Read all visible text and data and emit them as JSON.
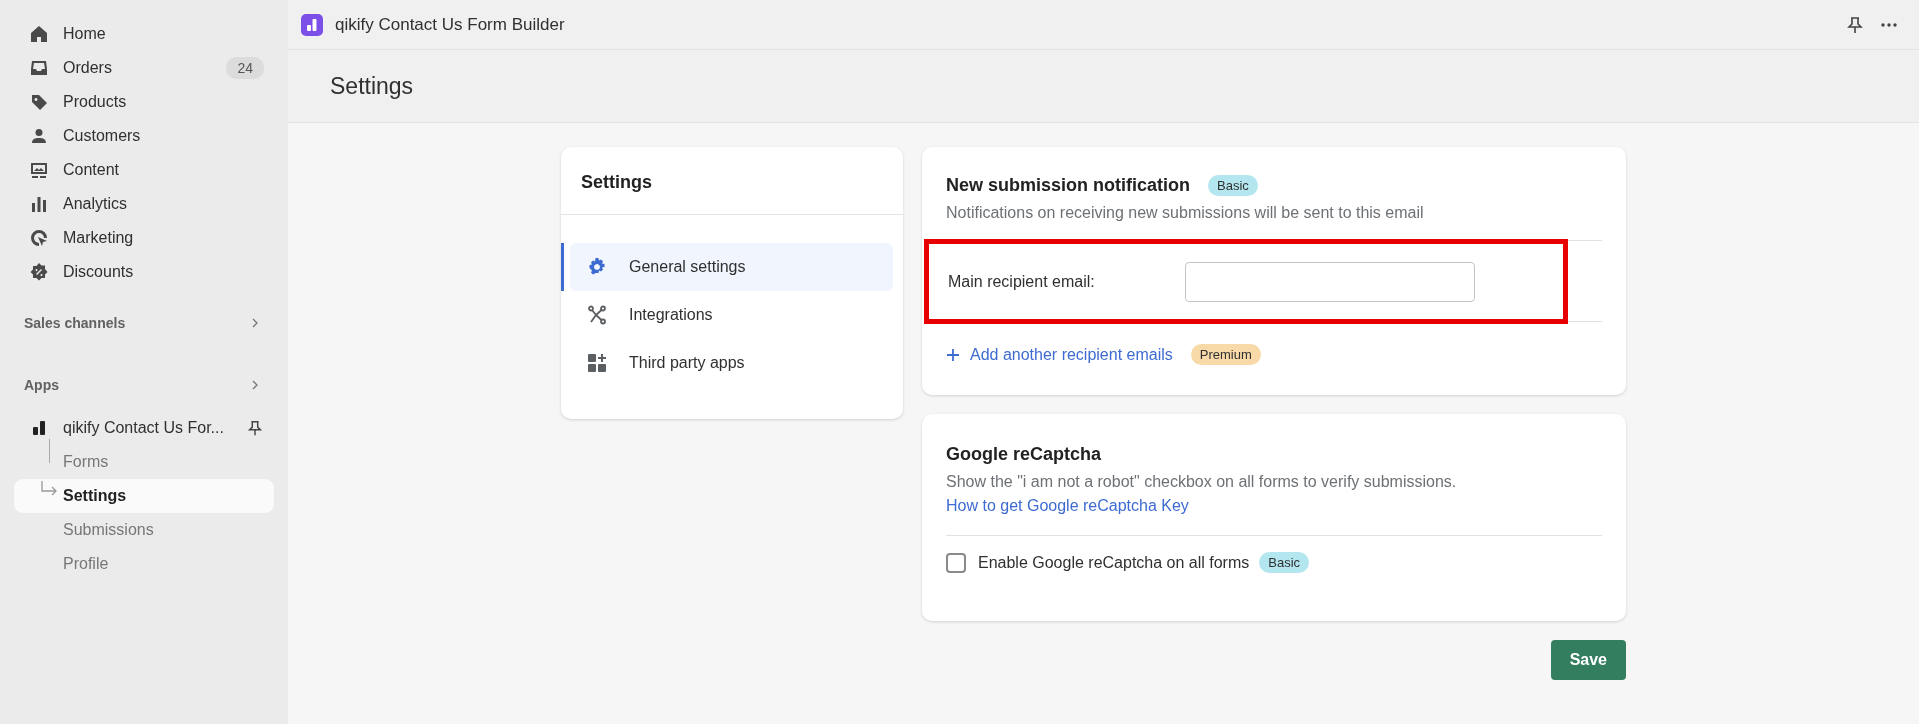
{
  "sidebar": {
    "nav": [
      {
        "label": "Home"
      },
      {
        "label": "Orders",
        "badge": "24"
      },
      {
        "label": "Products"
      },
      {
        "label": "Customers"
      },
      {
        "label": "Content"
      },
      {
        "label": "Analytics"
      },
      {
        "label": "Marketing"
      },
      {
        "label": "Discounts"
      }
    ],
    "sections": [
      {
        "label": "Sales channels"
      },
      {
        "label": "Apps"
      }
    ],
    "app": {
      "label": "qikify Contact Us For...",
      "children": [
        {
          "label": "Forms",
          "selected": false
        },
        {
          "label": "Settings",
          "selected": true
        },
        {
          "label": "Submissions",
          "selected": false
        },
        {
          "label": "Profile",
          "selected": false
        }
      ]
    }
  },
  "top_bar": {
    "title": "qikify Contact Us Form Builder"
  },
  "page": {
    "title": "Settings"
  },
  "settings_menu": {
    "title": "Settings",
    "items": [
      {
        "label": "General settings",
        "selected": true
      },
      {
        "label": "Integrations",
        "selected": false
      },
      {
        "label": "Third party apps",
        "selected": false
      }
    ]
  },
  "notification_card": {
    "title": "New submission notification",
    "badge": {
      "label": "Basic",
      "color": "#b4e6f0"
    },
    "description": "Notifications on receiving new submissions will be sent to this email",
    "field_label": "Main recipient email:",
    "add_link": "Add another recipient emails",
    "add_badge": {
      "label": "Premium",
      "color": "#f8d9a8"
    }
  },
  "recaptcha_card": {
    "title": "Google reCaptcha",
    "description": "Show the \"i am not a robot\" checkbox on all forms to verify submissions.",
    "link": "How to get Google reCaptcha Key",
    "checkbox": {
      "label": "Enable Google reCaptcha on all forms",
      "checked": false
    },
    "badge": {
      "label": "Basic",
      "color": "#b4e6f0"
    }
  },
  "save_button": "Save"
}
